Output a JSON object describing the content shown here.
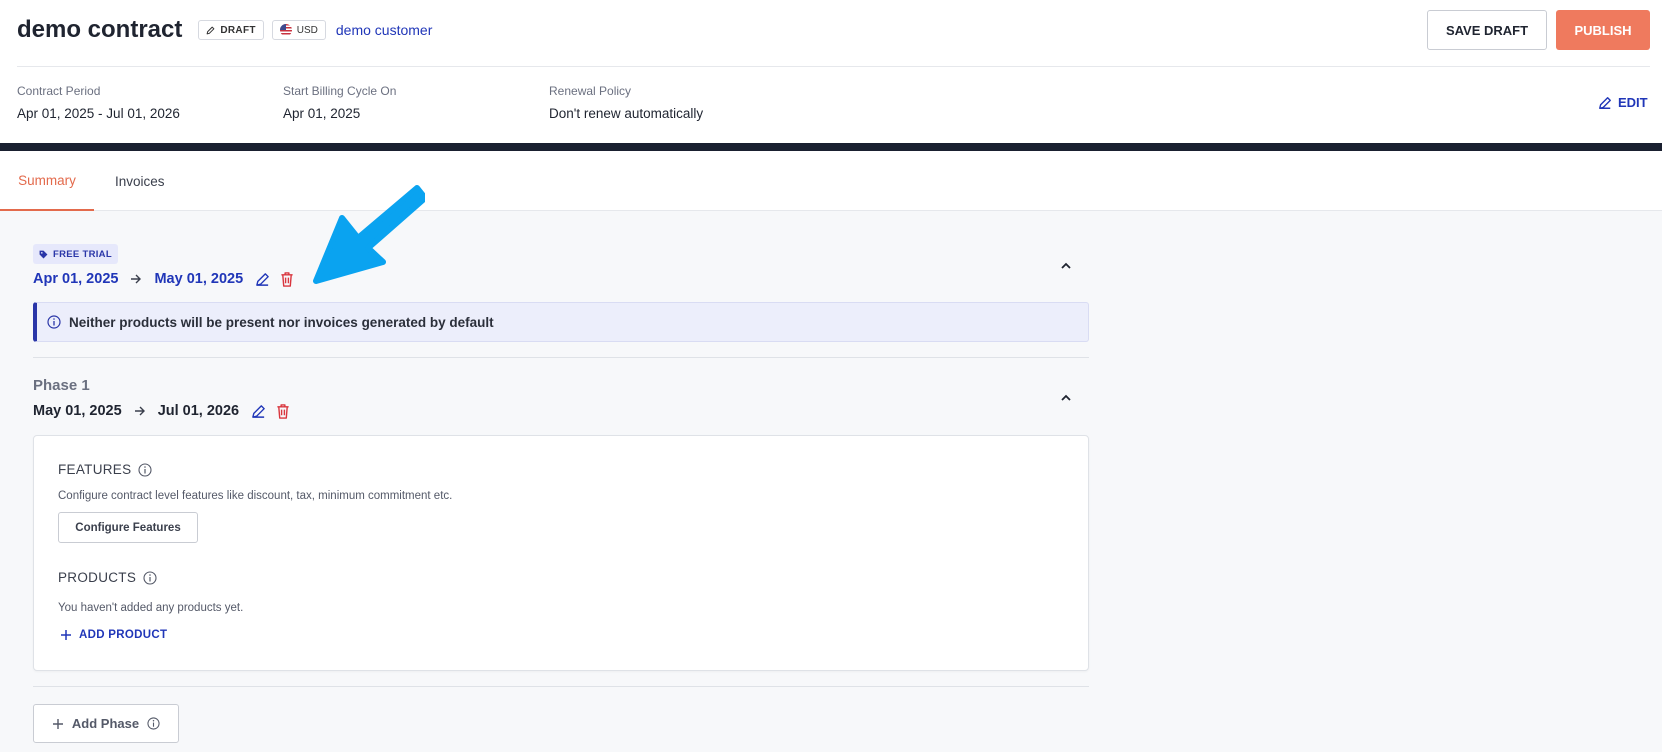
{
  "header": {
    "title": "demo contract",
    "draft_badge": "DRAFT",
    "currency_badge": "USD",
    "customer": "demo customer",
    "save_draft_label": "SAVE DRAFT",
    "publish_label": "PUBLISH",
    "edit_label": "EDIT"
  },
  "meta": {
    "contract_period": {
      "label": "Contract Period",
      "value": "Apr 01, 2025 - Jul 01, 2026"
    },
    "billing_cycle": {
      "label": "Start Billing Cycle On",
      "value": "Apr 01, 2025"
    },
    "renewal_policy": {
      "label": "Renewal Policy",
      "value": "Don't renew automatically"
    }
  },
  "tabs": [
    {
      "label": "Summary",
      "active": true
    },
    {
      "label": "Invoices",
      "active": false
    }
  ],
  "free_trial": {
    "badge": "FREE TRIAL",
    "start": "Apr 01, 2025",
    "end": "May 01, 2025",
    "info": "Neither products will be present nor invoices generated by default"
  },
  "phase1": {
    "title": "Phase 1",
    "start": "May 01, 2025",
    "end": "Jul 01, 2026",
    "features": {
      "title": "FEATURES",
      "description": "Configure contract level features like discount, tax, minimum commitment etc.",
      "button": "Configure Features"
    },
    "products": {
      "title": "PRODUCTS",
      "empty_text": "You haven't added any products yet.",
      "add_label": "ADD PRODUCT"
    }
  },
  "add_phase_label": "Add Phase",
  "colors": {
    "accent": "#2036b8",
    "publish": "#ef7a5e",
    "active_tab": "#e36a4c",
    "delete": "#d9363e",
    "pointer": "#0aa3f0"
  }
}
